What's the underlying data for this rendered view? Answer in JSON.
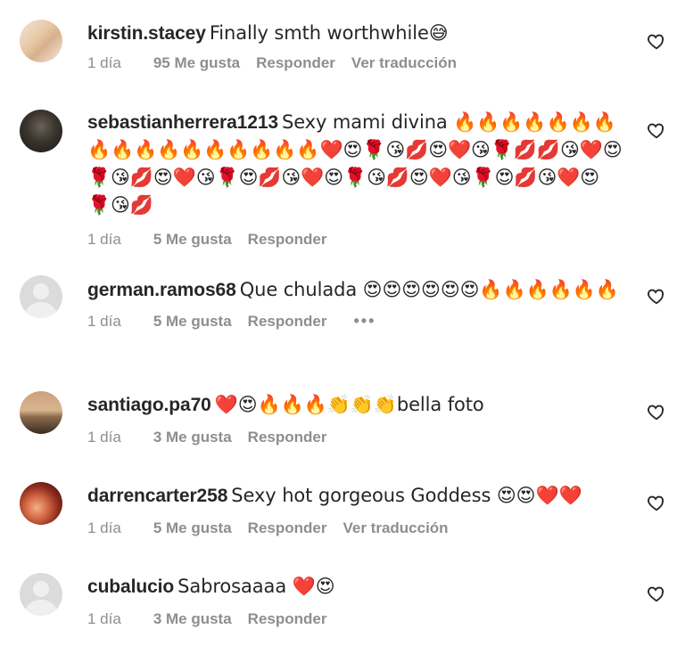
{
  "comments": [
    {
      "username": "kirstin.stacey",
      "text": "Finally smth worthwhile😅",
      "time": "1 día",
      "likes": "95 Me gusta",
      "reply": "Responder",
      "translate": "Ver traducción",
      "avatar": "photo-blonde"
    },
    {
      "username": "sebastianherrera1213",
      "text": "Sexy mami divina 🔥🔥🔥🔥🔥🔥🔥🔥🔥🔥🔥🔥🔥🔥🔥🔥🔥❤️😍🌹😘💋😍❤️😘🌹💋💋😘❤️😍🌹😘💋😍❤️😘🌹😍💋😘❤️😍🌹😘💋😍❤️😘🌹😍💋😘❤️😍🌹😘💋",
      "time": "1 día",
      "likes": "5 Me gusta",
      "reply": "Responder",
      "avatar": "photo-dark"
    },
    {
      "username": "german.ramos68",
      "text": "Que chulada 😍😍😍😍😍😍🔥🔥🔥🔥🔥🔥",
      "time": "1 día",
      "likes": "5 Me gusta",
      "reply": "Responder",
      "more": "•••",
      "avatar": "default"
    },
    {
      "username": "santiago.pa70",
      "text": "❤️😍🔥🔥🔥👏👏👏bella foto",
      "time": "1 día",
      "likes": "3 Me gusta",
      "reply": "Responder",
      "avatar": "photo-sunset"
    },
    {
      "username": "darrencarter258",
      "text": "Sexy hot gorgeous Goddess 😍😍❤️❤️",
      "time": "1 día",
      "likes": "5 Me gusta",
      "reply": "Responder",
      "translate": "Ver traducción",
      "avatar": "photo-red"
    },
    {
      "username": "cubalucio",
      "text": "Sabrosaaaa ❤️😍",
      "time": "1 día",
      "likes": "3 Me gusta",
      "reply": "Responder",
      "avatar": "default"
    }
  ],
  "icons": {
    "like": "heart-outline-icon"
  },
  "colors": {
    "text": "#262626",
    "meta": "#8e8e8e"
  }
}
